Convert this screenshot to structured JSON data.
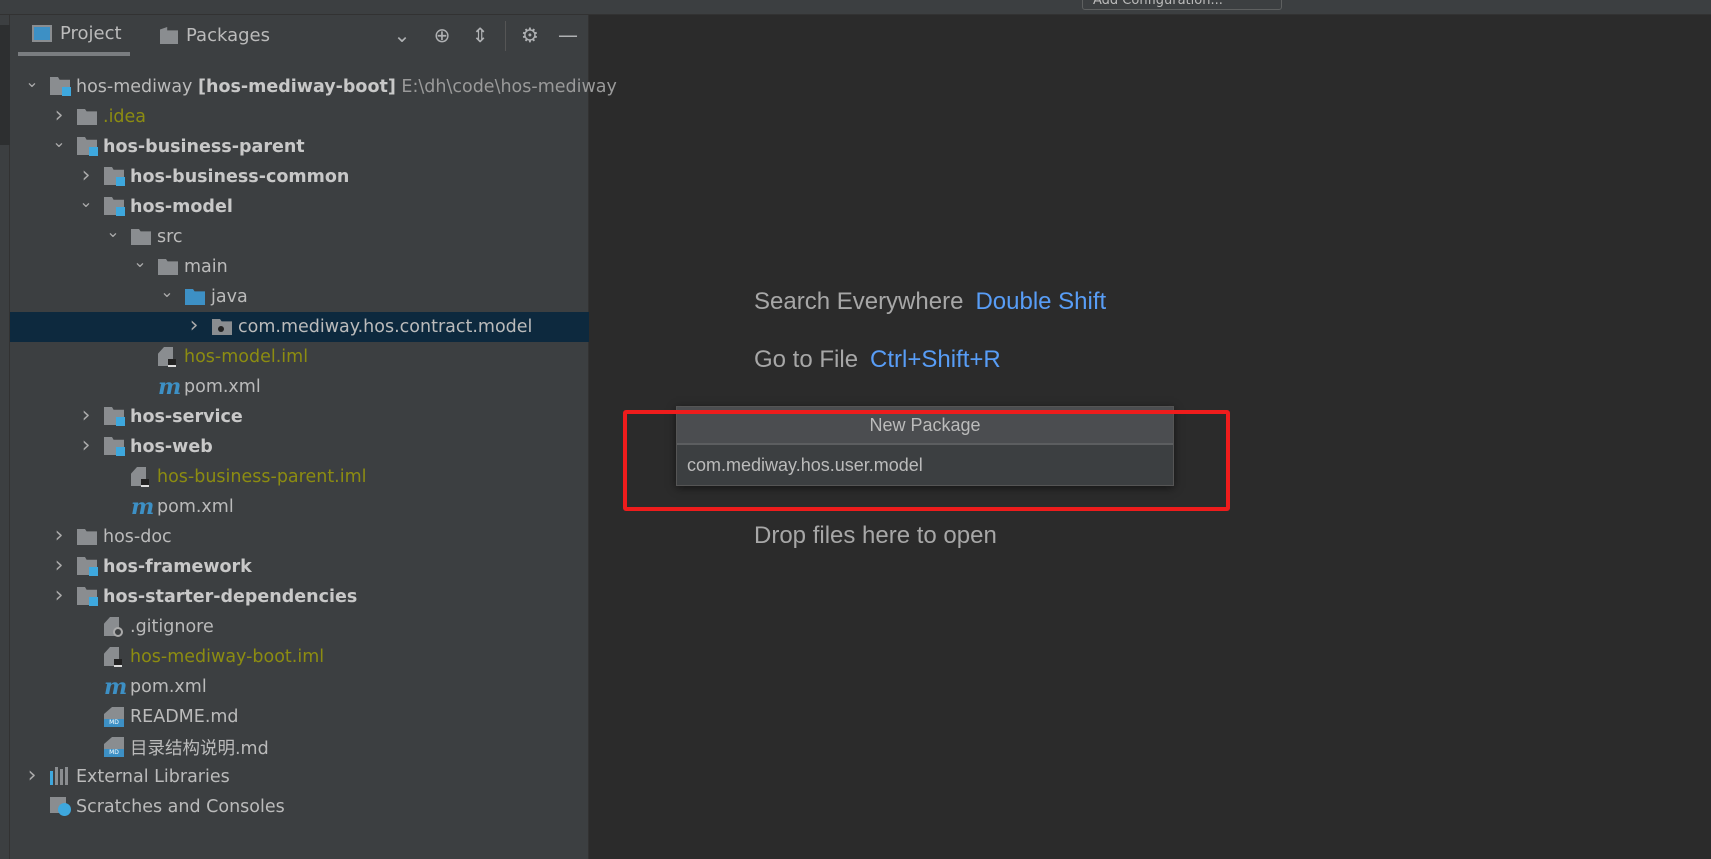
{
  "toolbar": {
    "run_config_label": "Add Configuration..."
  },
  "panel": {
    "tabs": [
      {
        "label": "Project",
        "icon": "project-icon",
        "active": true
      },
      {
        "label": "Packages",
        "icon": "package-icon",
        "active": false
      }
    ],
    "tools": [
      "chevron-down-icon",
      "locate-icon",
      "collapse-all-icon",
      "gear-icon",
      "minimize-icon"
    ]
  },
  "tree": [
    {
      "level": 0,
      "chev": "down",
      "icon": "module",
      "label": "hos-mediway",
      "extra": "[hos-mediway-boot]",
      "hint": "E:\\dh\\code\\hos-mediway"
    },
    {
      "level": 1,
      "chev": "right",
      "icon": "folder",
      "label": ".idea",
      "style": "olive"
    },
    {
      "level": 1,
      "chev": "down",
      "icon": "module",
      "label": "hos-business-parent",
      "style": "bold"
    },
    {
      "level": 2,
      "chev": "right",
      "icon": "module",
      "label": "hos-business-common",
      "style": "bold"
    },
    {
      "level": 2,
      "chev": "down",
      "icon": "module",
      "label": "hos-model",
      "style": "bold"
    },
    {
      "level": 3,
      "chev": "down",
      "icon": "folder",
      "label": "src"
    },
    {
      "level": 4,
      "chev": "down",
      "icon": "folder",
      "label": "main"
    },
    {
      "level": 5,
      "chev": "down",
      "icon": "src-folder",
      "label": "java"
    },
    {
      "level": 6,
      "chev": "right",
      "icon": "package",
      "label": "com.mediway.hos.contract.model",
      "selected": true
    },
    {
      "level": 4,
      "icon": "iml",
      "label": "hos-model.iml",
      "style": "olive"
    },
    {
      "level": 4,
      "icon": "maven",
      "label": "pom.xml"
    },
    {
      "level": 2,
      "chev": "right",
      "icon": "module",
      "label": "hos-service",
      "style": "bold"
    },
    {
      "level": 2,
      "chev": "right",
      "icon": "module",
      "label": "hos-web",
      "style": "bold"
    },
    {
      "level": 3,
      "icon": "iml",
      "label": "hos-business-parent.iml",
      "style": "olive"
    },
    {
      "level": 3,
      "icon": "maven",
      "label": "pom.xml"
    },
    {
      "level": 1,
      "chev": "right",
      "icon": "folder",
      "label": "hos-doc"
    },
    {
      "level": 1,
      "chev": "right",
      "icon": "module",
      "label": "hos-framework",
      "style": "bold"
    },
    {
      "level": 1,
      "chev": "right",
      "icon": "module",
      "label": "hos-starter-dependencies",
      "style": "bold"
    },
    {
      "level": 2,
      "icon": "gitignore",
      "label": ".gitignore"
    },
    {
      "level": 2,
      "icon": "iml",
      "label": "hos-mediway-boot.iml",
      "style": "olive"
    },
    {
      "level": 2,
      "icon": "maven",
      "label": "pom.xml"
    },
    {
      "level": 2,
      "icon": "markdown",
      "label": "README.md"
    },
    {
      "level": 2,
      "icon": "markdown",
      "label": "目录结构说明.md"
    },
    {
      "level": 0,
      "chev": "right",
      "icon": "libraries",
      "label": "External Libraries"
    },
    {
      "level": 0,
      "icon": "scratches",
      "label": "Scratches and Consoles"
    }
  ],
  "editor": {
    "hints": [
      {
        "text": "Search Everywhere",
        "key": "Double Shift"
      },
      {
        "text": "Go to File",
        "key": "Ctrl+Shift+R"
      },
      {
        "text": "Drop files here to open",
        "key": ""
      }
    ]
  },
  "dialog": {
    "title": "New Package",
    "value": "com.mediway.hos.user.model"
  },
  "colors": {
    "accent": "#589df6",
    "highlight": "#ee1c1c",
    "selection": "#0d293e",
    "olive": "#8c8c11",
    "module_badge": "#3ea8de"
  }
}
